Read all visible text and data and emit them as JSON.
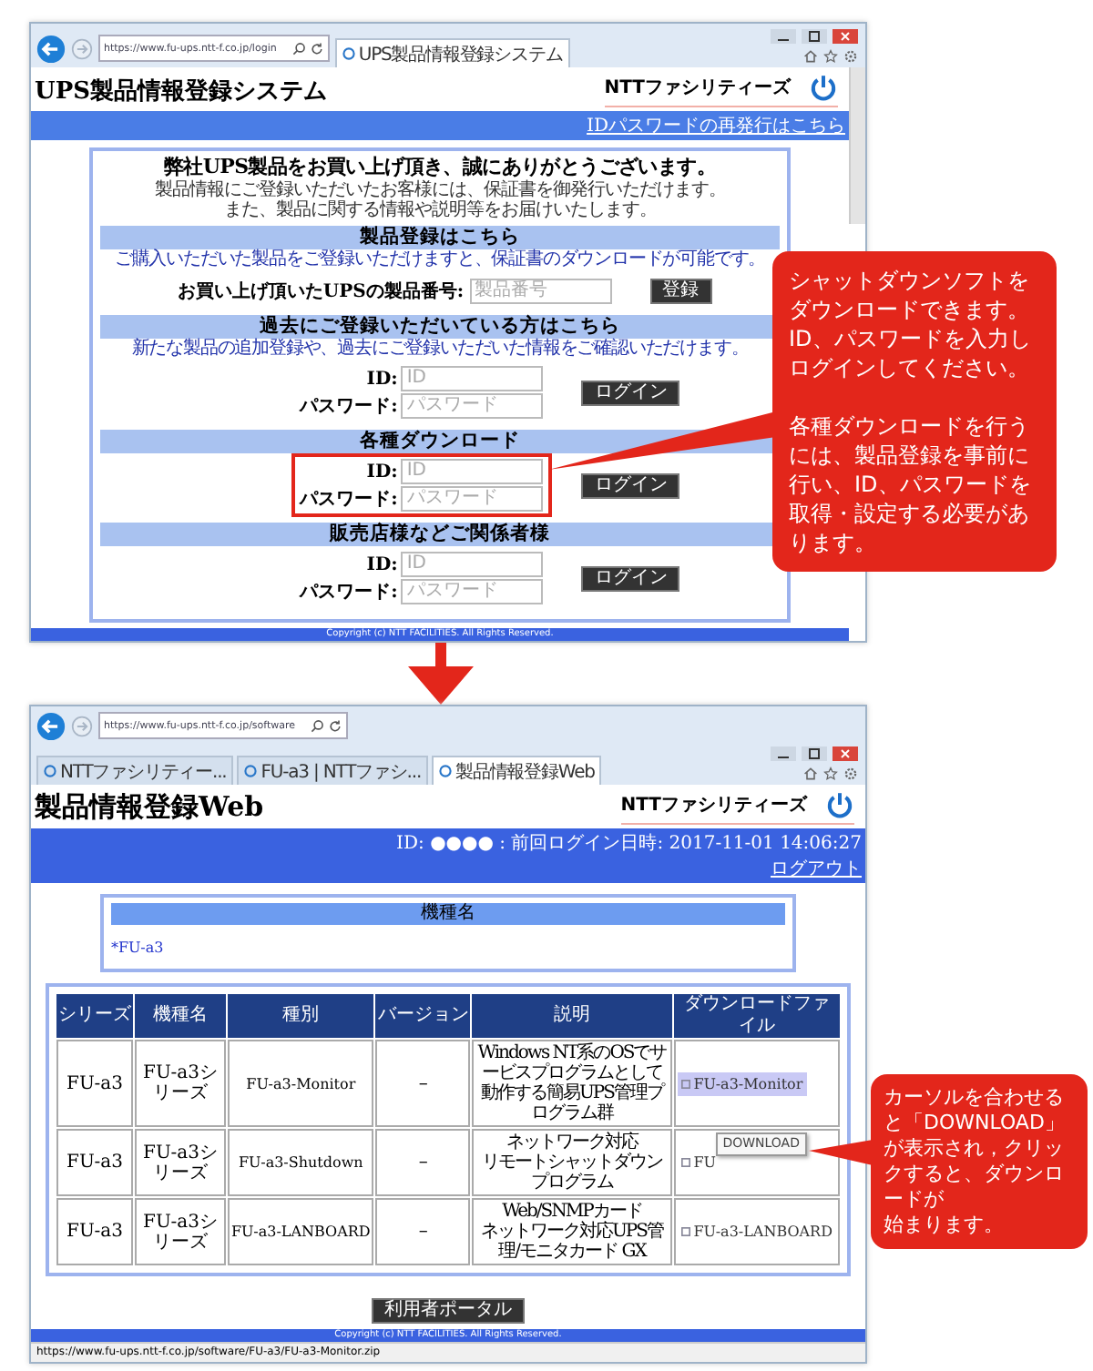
{
  "windows": [
    {
      "address": "https://www.fu-ups.ntt-f.co.jp/login",
      "tabs": [
        {
          "title": "UPS製品情報登録システム",
          "selected": true
        }
      ],
      "site_title": "UPS製品情報登録システム",
      "logo": "NTTファシリティーズ",
      "top_link": "IDパスワードの再発行はこちら",
      "greeting": "弊社UPS製品をお買い上げ頂き、誠にありがとうございます。",
      "intro": [
        "製品情報にご登録いただいたお客様には、保証書を御発行いただけます。",
        "また、製品に関する情報や説明等をお届けいたします。"
      ],
      "sections": [
        {
          "kind": "register",
          "heading": "製品登録はこちら",
          "note": "ご購入いただいた製品をご登録いただけますと、保証書のダウンロードが可能です。",
          "fields": [
            {
              "label": "お買い上げ頂いたUPSの製品番号:",
              "placeholder": "製品番号"
            }
          ],
          "button": "登録",
          "highlighted": false
        },
        {
          "kind": "login",
          "heading": "過去にご登録いただいている方はこちら",
          "note": "新たな製品の追加登録や、過去にご登録いただいた情報をご確認いただけます。",
          "fields": [
            {
              "label": "ID:",
              "placeholder": "ID"
            },
            {
              "label": "パスワード:",
              "placeholder": "パスワード"
            }
          ],
          "button": "ログイン",
          "highlighted": false
        },
        {
          "kind": "login",
          "heading": "各種ダウンロード",
          "fields": [
            {
              "label": "ID:",
              "placeholder": "ID"
            },
            {
              "label": "パスワード:",
              "placeholder": "パスワード"
            }
          ],
          "button": "ログイン",
          "highlighted": true
        },
        {
          "kind": "login",
          "heading": "販売店様などご関係者様",
          "fields": [
            {
              "label": "ID:",
              "placeholder": "ID"
            },
            {
              "label": "パスワード:",
              "placeholder": "パスワード"
            }
          ],
          "button": "ログイン",
          "highlighted": false
        }
      ],
      "footer": "Copyright (c) NTT FACILITIES. All Rights Reserved."
    },
    {
      "address": "https://www.fu-ups.ntt-f.co.jp/software",
      "tabs": [
        {
          "title": "NTTファシリティー...",
          "selected": false
        },
        {
          "title": "FU-a3 | NTTファシ...",
          "selected": false
        },
        {
          "title": "製品情報登録Web",
          "selected": true
        }
      ],
      "site_title": "製品情報登録Web",
      "logo": "NTTファシリティーズ",
      "user_info": "ID: ●●●● : 前回ログイン日時: 2017-11-01 14:06:27",
      "logout": "ログアウト",
      "model_box": {
        "heading": "機種名",
        "items": [
          "*FU-a3"
        ]
      },
      "columns": [
        "シリーズ",
        "機種名",
        "種別",
        "バージョン",
        "説明",
        "ダウンロードファイル"
      ],
      "rows": [
        {
          "series": "FU-a3",
          "model": "FU-a3シリーズ",
          "type": "FU-a3-Monitor",
          "version": "–",
          "description": [
            "Windows NT系のOSでサービスプログラムとして",
            "動作する簡易UPS管理プログラム群"
          ],
          "file": "FU-a3-Monitor",
          "hovered": true,
          "tooltip": ""
        },
        {
          "series": "FU-a3",
          "model": "FU-a3シリーズ",
          "type": "FU-a3-Shutdown",
          "version": "–",
          "description": [
            "ネットワーク対応",
            "リモートシャットダウンプログラム"
          ],
          "file": "FU",
          "hovered": false,
          "tooltip": "DOWNLOAD"
        },
        {
          "series": "FU-a3",
          "model": "FU-a3シリーズ",
          "type": "FU-a3-LANBOARD",
          "version": "–",
          "description": [
            "Web/SNMPカード",
            "ネットワーク対応UPS管理/モニタカード GX"
          ],
          "file": "FU-a3-LANBOARD",
          "hovered": false,
          "tooltip": ""
        }
      ],
      "portal_button": "利用者ポータル",
      "footer": "Copyright (c) NTT FACILITIES. All Rights Reserved.",
      "status_url": "https://www.fu-ups.ntt-f.co.jp/software/FU-a3/FU-a3-Monitor.zip"
    }
  ],
  "callouts": [
    {
      "paragraphs": [
        "シャットダウンソフトをダウンロードできます。ID、パスワードを入力しログインしてください。",
        "各種ダウンロードを行うには、製品登録を事前に行い、ID、パスワードを取得・設定する必要があります。"
      ]
    },
    {
      "lines": [
        "カーソルを合わせると「DOWNLOAD」が表示され，クリックすると、ダウンロードが",
        "始まります。"
      ]
    }
  ]
}
